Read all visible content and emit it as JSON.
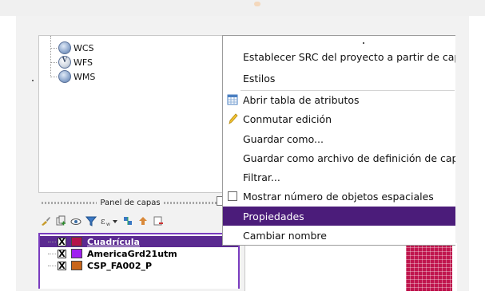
{
  "browser": {
    "items": [
      {
        "label": "WCS",
        "icon": "globe-wcs-icon"
      },
      {
        "label": "WFS",
        "icon": "globe-wfs-icon",
        "glyph": "V"
      },
      {
        "label": "WMS",
        "icon": "globe-wms-icon"
      }
    ]
  },
  "layers_panel": {
    "title": "Panel de capas",
    "toolbar_icons": [
      "style-brush-icon",
      "add-group-icon",
      "visibility-eye-icon",
      "filter-icon",
      "filter-expression-icon",
      "expand-all-icon",
      "collapse-all-icon",
      "remove-layer-icon"
    ],
    "layers": [
      {
        "name": "Cuadrícula",
        "checked": true,
        "swatch": "#b5134a",
        "selected": true
      },
      {
        "name": "AmericaGrd21utm",
        "checked": true,
        "swatch": "#a020f0",
        "selected": false
      },
      {
        "name": "CSP_FA002_P",
        "checked": true,
        "swatch": "#c8651b",
        "selected": false
      }
    ],
    "check_mark": "X"
  },
  "context_menu": {
    "items": [
      {
        "label": "Establecer SRC del proyecto a partir de capa",
        "icon": null
      },
      {
        "label": "Estilos",
        "icon": null
      },
      {
        "label": "Abrir tabla de atributos",
        "icon": "attribute-table-icon"
      },
      {
        "label": "Conmutar edición",
        "icon": "pencil-edit-icon"
      },
      {
        "label": "Guardar como...",
        "icon": null
      },
      {
        "label": "Guardar como archivo de definición de capa...",
        "icon": null
      },
      {
        "label": "Filtrar...",
        "icon": null
      },
      {
        "label": "Mostrar número de objetos espaciales",
        "icon": "checkbox-unchecked-icon"
      },
      {
        "label": "Propiedades",
        "icon": null,
        "highlighted": true
      },
      {
        "label": "Cambiar nombre",
        "icon": null
      }
    ]
  },
  "colors": {
    "highlight": "#4b1c7a",
    "selected_layer": "#5b2a91",
    "grid_fill": "#c0164e"
  }
}
